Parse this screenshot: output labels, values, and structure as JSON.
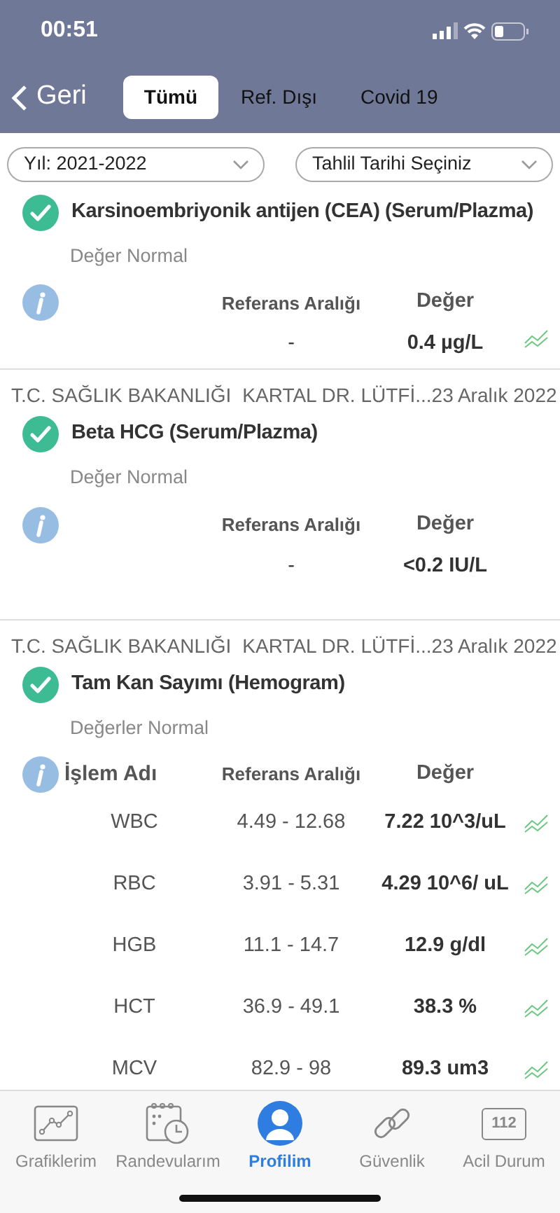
{
  "status_bar": {
    "time": "00:51"
  },
  "nav": {
    "back": "Geri",
    "tabs": [
      {
        "label": "Tümü",
        "selected": true
      },
      {
        "label": "Ref. Dışı",
        "selected": false
      },
      {
        "label": "Covid 19",
        "selected": false
      }
    ]
  },
  "filters": [
    {
      "label": "Yıl: 2021-2022"
    },
    {
      "label": "Tahlil Tarihi Seçiniz"
    }
  ],
  "results": [
    {
      "title": "Karsinoembriyonik antijen (CEA) (Serum/Plazma)",
      "status": "Değer Normal",
      "normal": true,
      "columns": [
        "Referans Aralığı",
        "Değer"
      ],
      "rows": [
        {
          "reference": "-",
          "value": "0.4 µg/L",
          "trend": true
        }
      ]
    },
    {
      "institution": "T.C. SAĞLIK BAKANLIĞI",
      "hospital": "KARTAL DR. LÜTFİ...",
      "date": "23 Aralık 2022",
      "title": "Beta HCG (Serum/Plazma)",
      "status": "Değer Normal",
      "normal": true,
      "columns": [
        "Referans Aralığı",
        "Değer"
      ],
      "rows": [
        {
          "reference": "-",
          "value": "<0.2 IU/L",
          "trend": false
        }
      ]
    },
    {
      "institution": "T.C. SAĞLIK BAKANLIĞI",
      "hospital": "KARTAL DR. LÜTFİ...",
      "date": "23 Aralık 2022",
      "title": "Tam Kan Sayımı (Hemogram)",
      "status": "Değerler Normal",
      "normal": true,
      "columns": [
        "İşlem Adı",
        "Referans Aralığı",
        "Değer"
      ],
      "rows": [
        {
          "name": "WBC",
          "reference": "4.49 - 12.68",
          "value": "7.22 10^3/uL",
          "trend": true
        },
        {
          "name": "RBC",
          "reference": "3.91 - 5.31",
          "value": "4.29 10^6/ uL",
          "trend": true
        },
        {
          "name": "HGB",
          "reference": "11.1 - 14.7",
          "value": "12.9 g/dl",
          "trend": true
        },
        {
          "name": "HCT",
          "reference": "36.9 - 49.1",
          "value": "38.3 %",
          "trend": true
        },
        {
          "name": "MCV",
          "reference": "82.9 - 98",
          "value": "89.3 um3",
          "trend": true
        }
      ]
    }
  ],
  "tab_bar": [
    {
      "label": "Grafiklerim",
      "selected": false
    },
    {
      "label": "Randevularım",
      "selected": false
    },
    {
      "label": "Profilim",
      "selected": true
    },
    {
      "label": "Güvenlik",
      "selected": false
    },
    {
      "label": "Acil Durum",
      "badge": "112",
      "selected": false
    }
  ]
}
